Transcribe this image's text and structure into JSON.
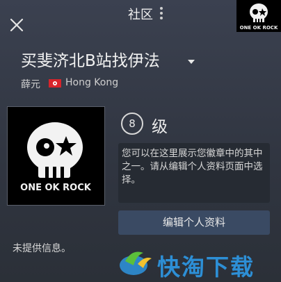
{
  "header": {
    "title": "社区",
    "close_icon": "close-icon",
    "more_icon": "more-vertical-icon",
    "corner_logo_text": "ONE OK ROCK"
  },
  "profile": {
    "display_name": "买斐济北B站找伊法",
    "real_name": "薛元",
    "flag_icon": "hong-kong-flag-icon",
    "location": "Hong Kong",
    "avatar_text": "ONE OK ROCK",
    "level_number": "8",
    "level_label": "级",
    "badge_hint": "您可以在这里展示您徽章中的其中之一。请从编辑个人资料页面中选择。",
    "edit_button_label": "编辑个人资料",
    "no_info": "未提供信息。"
  },
  "watermark": {
    "text": "快淘下载"
  },
  "colors": {
    "background": "#343a46",
    "panel": "#262b33",
    "button": "#3a4a63",
    "watermark": "#2d8fd6"
  }
}
